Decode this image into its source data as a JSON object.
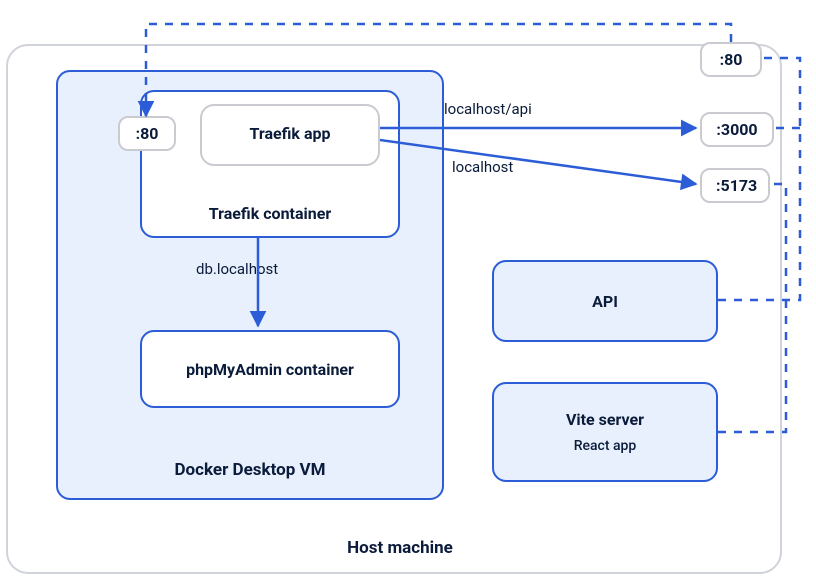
{
  "host": {
    "label": "Host machine"
  },
  "docker_vm": {
    "label": "Docker Desktop VM"
  },
  "traefik_container": {
    "label": "Traefik container"
  },
  "traefik_app": {
    "label": "Traefik app"
  },
  "phpmyadmin": {
    "label": "phpMyAdmin container"
  },
  "api_box": {
    "label": "API"
  },
  "vite_box": {
    "title": "Vite server",
    "subtitle": "React app"
  },
  "ports": {
    "p80_host": ":80",
    "p80_vm": ":80",
    "p3000": ":3000",
    "p5173": ":5173"
  },
  "edges": {
    "to_api_route": "localhost/api",
    "to_vite_route": "localhost",
    "to_phpmyadmin": "db.localhost"
  }
}
